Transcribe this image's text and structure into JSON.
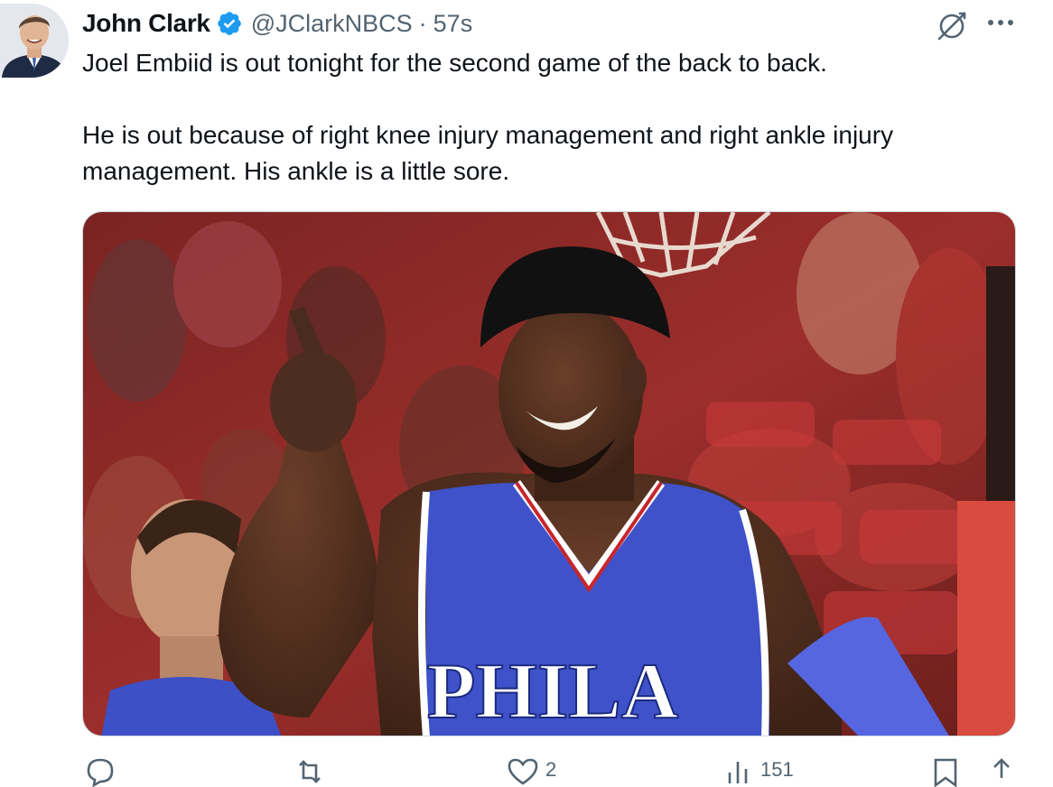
{
  "author": {
    "display_name": "John Clark",
    "handle": "@JClarkNBCS",
    "separator": "·",
    "timestamp": "57s",
    "verified": true,
    "verified_color": "#1d9bf0"
  },
  "tweet": {
    "paragraphs": [
      "Joel Embiid is out tonight for the second game of the back to back.",
      "He is out because of right knee injury management and right ankle injury management. His ankle is a little sore."
    ]
  },
  "media": {
    "jersey_text": "PHILA",
    "jersey_color": "#3f52c9",
    "background_color": "#8a2a28"
  },
  "actions": {
    "reply_count": "",
    "retweet_count": "",
    "like_count": "2",
    "views_count": "151"
  },
  "icons": {
    "verified": "verified-badge-icon",
    "grok": "grok-icon",
    "more": "more-icon",
    "reply": "reply-icon",
    "retweet": "retweet-icon",
    "like": "like-icon",
    "views": "views-icon",
    "bookmark": "bookmark-icon",
    "share": "share-icon"
  }
}
